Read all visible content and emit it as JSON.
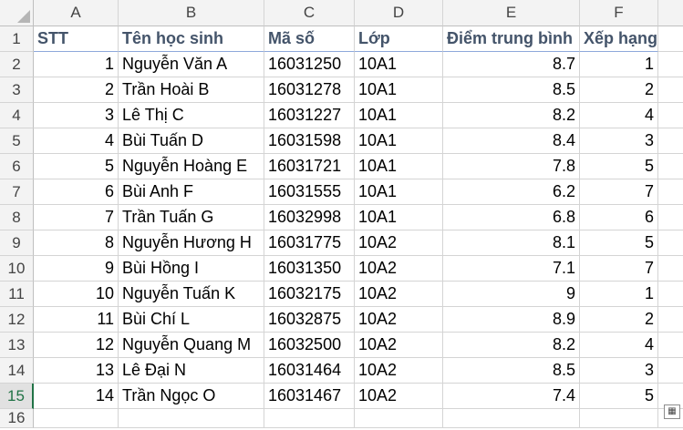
{
  "columns": [
    "A",
    "B",
    "C",
    "D",
    "E",
    "F"
  ],
  "row_numbers": [
    "1",
    "2",
    "3",
    "4",
    "5",
    "6",
    "7",
    "8",
    "9",
    "10",
    "11",
    "12",
    "13",
    "14",
    "15",
    "16"
  ],
  "headers": {
    "stt": "STT",
    "name": "Tên học sinh",
    "code": "Mã số",
    "class": "Lớp",
    "gpa": "Điểm trung bình",
    "rank": "Xếp hạng"
  },
  "rows": [
    {
      "stt": "1",
      "name": "Nguyễn Văn A",
      "code": "16031250",
      "class": "10A1",
      "gpa": "8.7",
      "rank": "1"
    },
    {
      "stt": "2",
      "name": "Trần Hoài B",
      "code": "16031278",
      "class": "10A1",
      "gpa": "8.5",
      "rank": "2"
    },
    {
      "stt": "3",
      "name": "Lê Thị C",
      "code": "16031227",
      "class": "10A1",
      "gpa": "8.2",
      "rank": "4"
    },
    {
      "stt": "4",
      "name": "Bùi Tuấn D",
      "code": "16031598",
      "class": "10A1",
      "gpa": "8.4",
      "rank": "3"
    },
    {
      "stt": "5",
      "name": "Nguyễn Hoàng E",
      "code": "16031721",
      "class": "10A1",
      "gpa": "7.8",
      "rank": "5"
    },
    {
      "stt": "6",
      "name": "Bùi Anh F",
      "code": "16031555",
      "class": "10A1",
      "gpa": "6.2",
      "rank": "7"
    },
    {
      "stt": "7",
      "name": "Trần Tuấn G",
      "code": "16032998",
      "class": "10A1",
      "gpa": "6.8",
      "rank": "6"
    },
    {
      "stt": "8",
      "name": "Nguyễn Hương H",
      "code": "16031775",
      "class": "10A2",
      "gpa": "8.1",
      "rank": "5"
    },
    {
      "stt": "9",
      "name": "Bùi Hồng I",
      "code": "16031350",
      "class": "10A2",
      "gpa": "7.1",
      "rank": "7"
    },
    {
      "stt": "10",
      "name": "Nguyễn Tuấn K",
      "code": "16032175",
      "class": "10A2",
      "gpa": "9",
      "rank": "1"
    },
    {
      "stt": "11",
      "name": "Bùi Chí L",
      "code": "16032875",
      "class": "10A2",
      "gpa": "8.9",
      "rank": "2"
    },
    {
      "stt": "12",
      "name": "Nguyễn Quang M",
      "code": "16032500",
      "class": "10A2",
      "gpa": "8.2",
      "rank": "4"
    },
    {
      "stt": "13",
      "name": "Lê Đại N",
      "code": "16031464",
      "class": "10A2",
      "gpa": "8.5",
      "rank": "3"
    },
    {
      "stt": "14",
      "name": "Trần Ngọc O",
      "code": "16031467",
      "class": "10A2",
      "gpa": "7.4",
      "rank": "5"
    }
  ],
  "quick_analysis_icon": "quick-analysis-icon",
  "colors": {
    "header_text": "#44546a",
    "selected_row_accent": "#217346",
    "gridline": "#d4d4d4"
  }
}
